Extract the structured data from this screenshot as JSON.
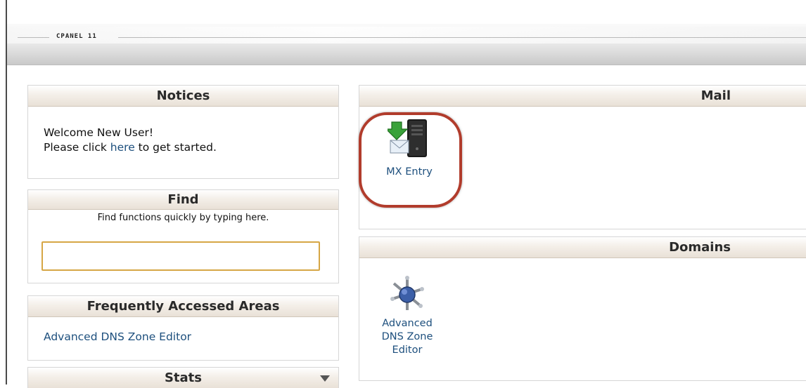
{
  "header": {
    "title": "CPANEL 11"
  },
  "notices": {
    "title": "Notices",
    "line1": "Welcome New User!",
    "line2_prefix": "Please click ",
    "line2_link": "here",
    "line2_suffix": " to get started."
  },
  "find": {
    "title": "Find",
    "hint": "Find functions quickly by typing here.",
    "input_value": ""
  },
  "frequently_accessed": {
    "title": "Frequently Accessed Areas",
    "items": [
      "Advanced DNS Zone Editor"
    ]
  },
  "stats": {
    "title": "Stats",
    "toggle_icon": "triangle-down-icon"
  },
  "mail": {
    "title": "Mail",
    "items": [
      {
        "label": "MX Entry",
        "icon": "mx-entry-icon"
      }
    ]
  },
  "domains": {
    "title": "Domains",
    "items": [
      {
        "label_lines": [
          "Advanced",
          "DNS Zone",
          "Editor"
        ],
        "icon": "dns-zone-editor-icon"
      }
    ]
  },
  "colors": {
    "link": "#1d4f7d",
    "highlight": "#b13c2c",
    "find_border": "#d6a645"
  }
}
